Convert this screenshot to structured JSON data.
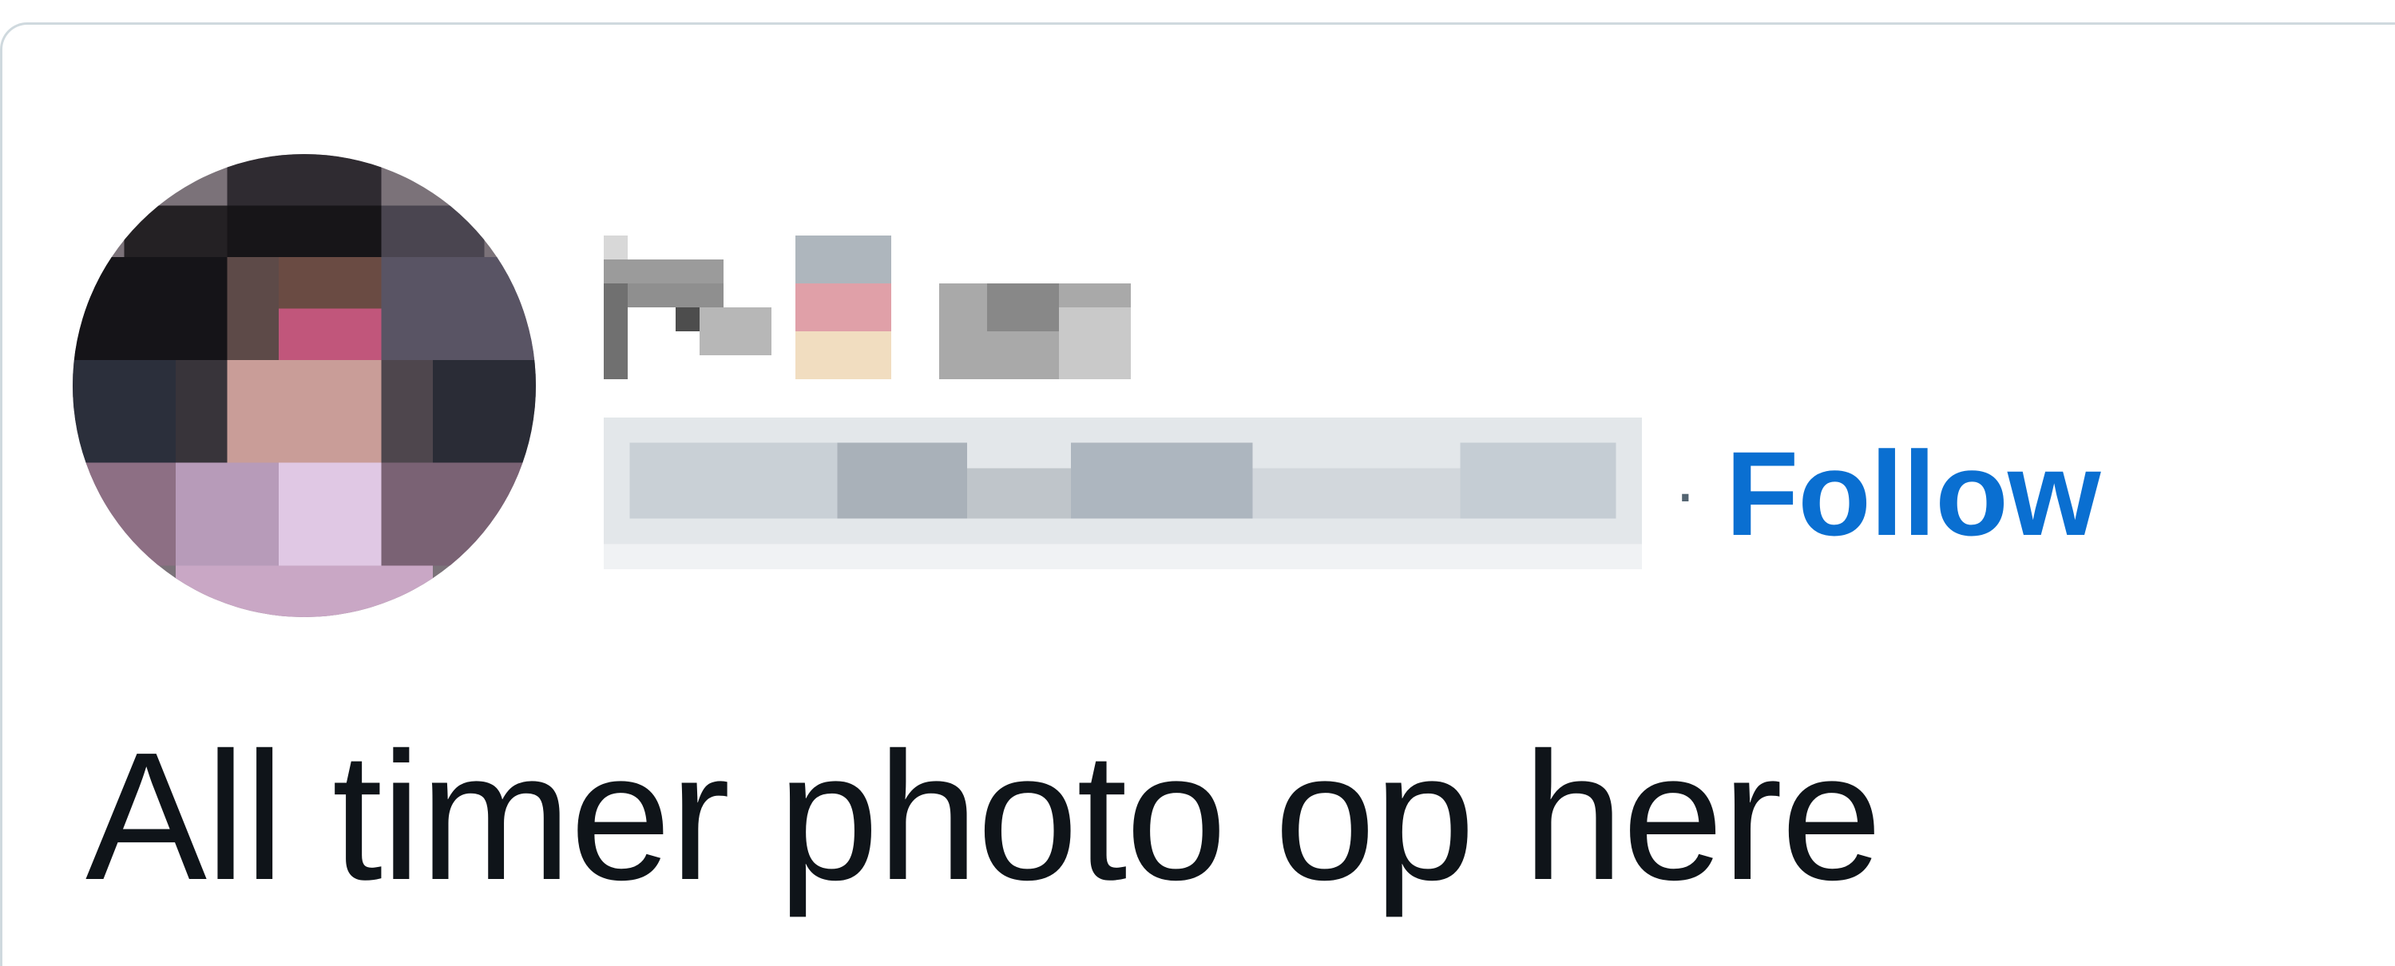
{
  "tweet": {
    "display_name": "",
    "handle": "",
    "separator": "·",
    "follow_label": "Follow",
    "text": "All timer photo op here"
  },
  "colors": {
    "follow": "#0a6fd1",
    "text": "#0f1419",
    "border": "#cfd9de"
  },
  "icons": {
    "avatar": "pixelated-avatar"
  }
}
